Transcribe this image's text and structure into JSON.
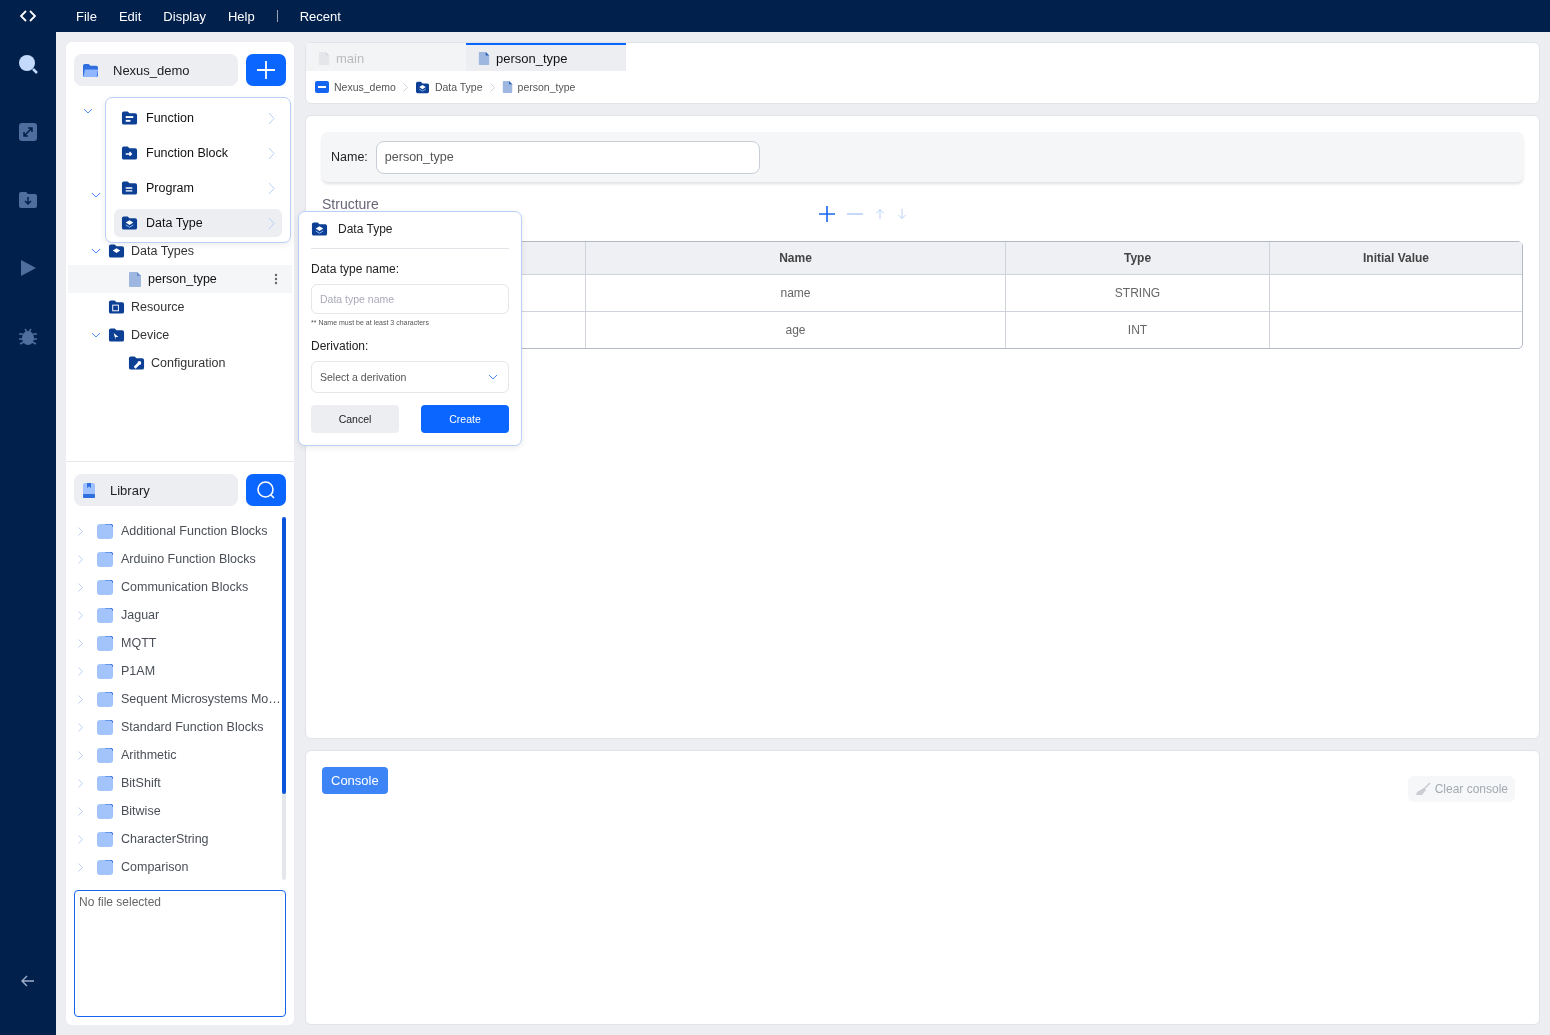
{
  "menu_bar": [
    {
      "kind": "menu",
      "label": "File"
    },
    {
      "kind": "menu",
      "label": "Edit"
    },
    {
      "kind": "menu",
      "label": "Display"
    },
    {
      "kind": "menu",
      "label": "Help"
    },
    {
      "kind": "separator"
    },
    {
      "kind": "menu",
      "label": "Recent"
    }
  ],
  "activity_bar": [
    {
      "kind": "search",
      "selected": true
    },
    {
      "kind": "expand",
      "selected": false
    },
    {
      "kind": "download",
      "selected": false
    },
    {
      "kind": "run",
      "selected": false
    },
    {
      "kind": "debug",
      "selected": false
    }
  ],
  "project": {
    "name": "Nexus_demo"
  },
  "tree": [
    {
      "kind": "folder",
      "expanded": true,
      "children": [
        {
          "kind": "item"
        },
        {
          "kind": "item"
        },
        {
          "kind": "folder",
          "expanded": true,
          "children": [
            {
              "kind": "item"
            }
          ]
        },
        {
          "kind": "folder",
          "label": "Data Types",
          "expanded": true,
          "selected": false,
          "children": [
            {
              "kind": "file",
              "label": "person_type",
              "selected": true
            }
          ]
        },
        {
          "kind": "item",
          "label": "Resource",
          "selected": false
        },
        {
          "kind": "folder",
          "label": "Device",
          "expanded": true,
          "selected": false,
          "children": [
            {
              "kind": "config",
              "label": "Configuration",
              "selected": false
            }
          ]
        }
      ]
    }
  ],
  "new_menu": [
    {
      "kind": "function",
      "label": "Function",
      "selected": false
    },
    {
      "kind": "function_block",
      "label": "Function Block",
      "selected": false
    },
    {
      "kind": "program",
      "label": "Program",
      "selected": false
    },
    {
      "kind": "data_type",
      "label": "Data Type",
      "selected": true
    }
  ],
  "library": {
    "title": "Library",
    "items": [
      "Additional Function Blocks",
      "Arduino Function Blocks",
      "Communication Blocks",
      "Jaguar",
      "MQTT",
      "P1AM",
      "Sequent Microsystems Mo…",
      "Standard Function Blocks",
      "Arithmetic",
      "BitShift",
      "Bitwise",
      "CharacterString",
      "Comparison"
    ]
  },
  "details_box": {
    "placeholder": "No file selected"
  },
  "dialog": {
    "title": "Data Type",
    "name_label": "Data type name:",
    "name_field": {
      "placeholder": "Data type name"
    },
    "hint": "** Name must be at least 3 characters",
    "derivation_label": "Derivation:",
    "derivation_field": {
      "placeholder": "Select a derivation"
    },
    "buttons": [
      {
        "kind": "secondary",
        "label": "Cancel"
      },
      {
        "kind": "primary",
        "label": "Create"
      }
    ]
  },
  "tabs": [
    {
      "label": "main",
      "selected": false
    },
    {
      "label": "person_type",
      "selected": true
    }
  ],
  "breadcrumb": [
    {
      "kind": "project",
      "label": "Nexus_demo"
    },
    {
      "kind": "folder",
      "label": "Data Type"
    },
    {
      "kind": "file",
      "label": "person_type"
    }
  ],
  "editor": {
    "name_label": "Name:",
    "name_value": "person_type",
    "structure_label": "Structure",
    "tools": [
      {
        "kind": "add",
        "disabled": false
      },
      {
        "kind": "remove",
        "disabled": true
      },
      {
        "kind": "up",
        "disabled": true
      },
      {
        "kind": "down",
        "disabled": true
      }
    ],
    "table": {
      "columns": [
        "Name",
        "Type",
        "Initial Value"
      ],
      "rows": [
        {
          "name": "name",
          "type": "STRING"
        },
        {
          "name": "age",
          "type": "INT"
        }
      ]
    }
  },
  "console": {
    "tab": "Console",
    "clear_button": {
      "label": "Clear console",
      "disabled": true
    }
  }
}
